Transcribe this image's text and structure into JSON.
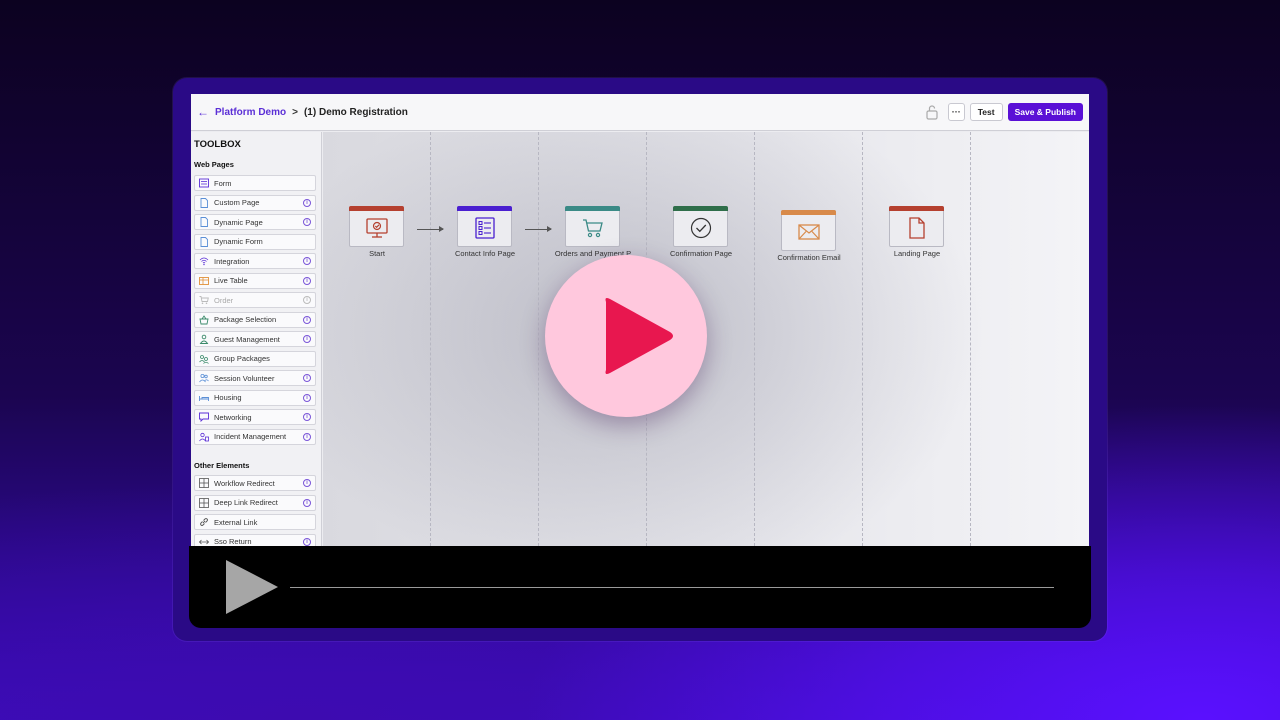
{
  "topbar": {
    "breadcrumb_link": "Platform Demo",
    "breadcrumb_sep": ">",
    "breadcrumb_current": "(1) Demo Registration",
    "more_label": "···",
    "test_label": "Test",
    "publish_label": "Save & Publish"
  },
  "toolbox": {
    "title": "TOOLBOX",
    "web_pages_heading": "Web Pages",
    "web_pages": [
      {
        "label": "Form",
        "icon": "form-icon",
        "info": false
      },
      {
        "label": "Custom Page",
        "icon": "page-icon",
        "info": true
      },
      {
        "label": "Dynamic Page",
        "icon": "page-icon",
        "info": true
      },
      {
        "label": "Dynamic Form",
        "icon": "page-icon",
        "info": false
      },
      {
        "label": "Integration",
        "icon": "wifi-icon",
        "info": true
      },
      {
        "label": "Live Table",
        "icon": "table-icon",
        "info": true
      },
      {
        "label": "Order",
        "icon": "cart-icon",
        "info": true,
        "disabled": true
      },
      {
        "label": "Package Selection",
        "icon": "basket-icon",
        "info": true
      },
      {
        "label": "Guest Management",
        "icon": "guest-icon",
        "info": true
      },
      {
        "label": "Group Packages",
        "icon": "group-icon",
        "info": false
      },
      {
        "label": "Session Volunteer",
        "icon": "volunteer-icon",
        "info": true
      },
      {
        "label": "Housing",
        "icon": "bed-icon",
        "info": true
      },
      {
        "label": "Networking",
        "icon": "chat-icon",
        "info": true
      },
      {
        "label": "Incident Management",
        "icon": "incident-icon",
        "info": true
      }
    ],
    "other_heading": "Other Elements",
    "other": [
      {
        "label": "Workflow Redirect",
        "icon": "redirect-icon",
        "info": true
      },
      {
        "label": "Deep Link Redirect",
        "icon": "redirect-icon",
        "info": true
      },
      {
        "label": "External Link",
        "icon": "link-icon",
        "info": false
      },
      {
        "label": "Sso Return",
        "icon": "return-icon",
        "info": true
      }
    ],
    "info_glyph": "i"
  },
  "flow": {
    "nodes": [
      {
        "label": "Start",
        "color": "#b5402f",
        "icon": "monitor-check-icon"
      },
      {
        "label": "Contact Info Page",
        "color": "#4a1fd0",
        "icon": "form-list-icon"
      },
      {
        "label": "Orders and Payment P",
        "color": "#3a8a86",
        "icon": "cart-icon"
      },
      {
        "label": "Confirmation Page",
        "color": "#2f6e4a",
        "icon": "check-circle-icon"
      },
      {
        "label": "Confirmation Email",
        "color": "#d88a4a",
        "icon": "mail-icon"
      },
      {
        "label": "Landing Page",
        "color": "#b5402f",
        "icon": "document-icon"
      }
    ]
  },
  "colors": {
    "accent": "#5a10d6",
    "play_circle": "#ffc8dd",
    "play_triangle": "#e8174f"
  }
}
